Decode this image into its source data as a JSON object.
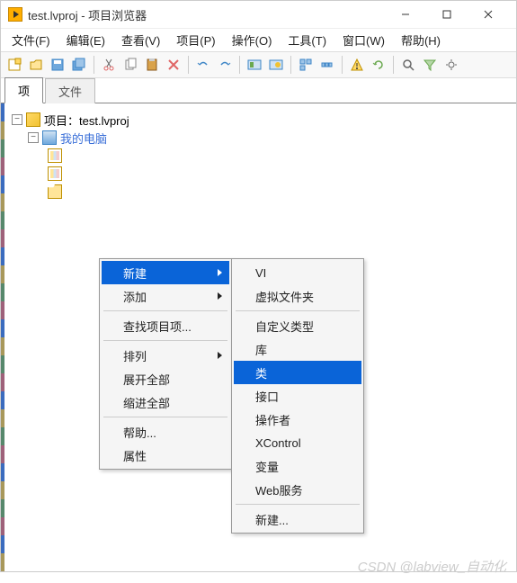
{
  "window": {
    "title": "test.lvproj - 项目浏览器"
  },
  "menubar": [
    "文件(F)",
    "编辑(E)",
    "查看(V)",
    "项目(P)",
    "操作(O)",
    "工具(T)",
    "窗口(W)",
    "帮助(H)"
  ],
  "tabs": {
    "active": "项",
    "inactive": "文件"
  },
  "tree": {
    "root": "项目：test.lvproj",
    "node1": "我的电脑"
  },
  "context_menu_1": {
    "items": [
      {
        "label": "新建",
        "submenu": true,
        "highlight": true
      },
      {
        "label": "添加",
        "submenu": true
      },
      {
        "sep": true
      },
      {
        "label": "查找项目项..."
      },
      {
        "sep": true
      },
      {
        "label": "排列",
        "submenu": true
      },
      {
        "label": "展开全部"
      },
      {
        "label": "缩进全部"
      },
      {
        "sep": true
      },
      {
        "label": "帮助..."
      },
      {
        "label": "属性"
      }
    ]
  },
  "context_menu_2": {
    "items": [
      {
        "label": "VI"
      },
      {
        "label": "虚拟文件夹"
      },
      {
        "sep": true
      },
      {
        "label": "自定义类型"
      },
      {
        "label": "库"
      },
      {
        "label": "类",
        "highlight": true
      },
      {
        "label": "接口"
      },
      {
        "label": "操作者"
      },
      {
        "label": "XControl"
      },
      {
        "label": "变量"
      },
      {
        "label": "Web服务"
      },
      {
        "sep": true
      },
      {
        "label": "新建..."
      }
    ]
  },
  "watermark": "CSDN @labview_自动化"
}
